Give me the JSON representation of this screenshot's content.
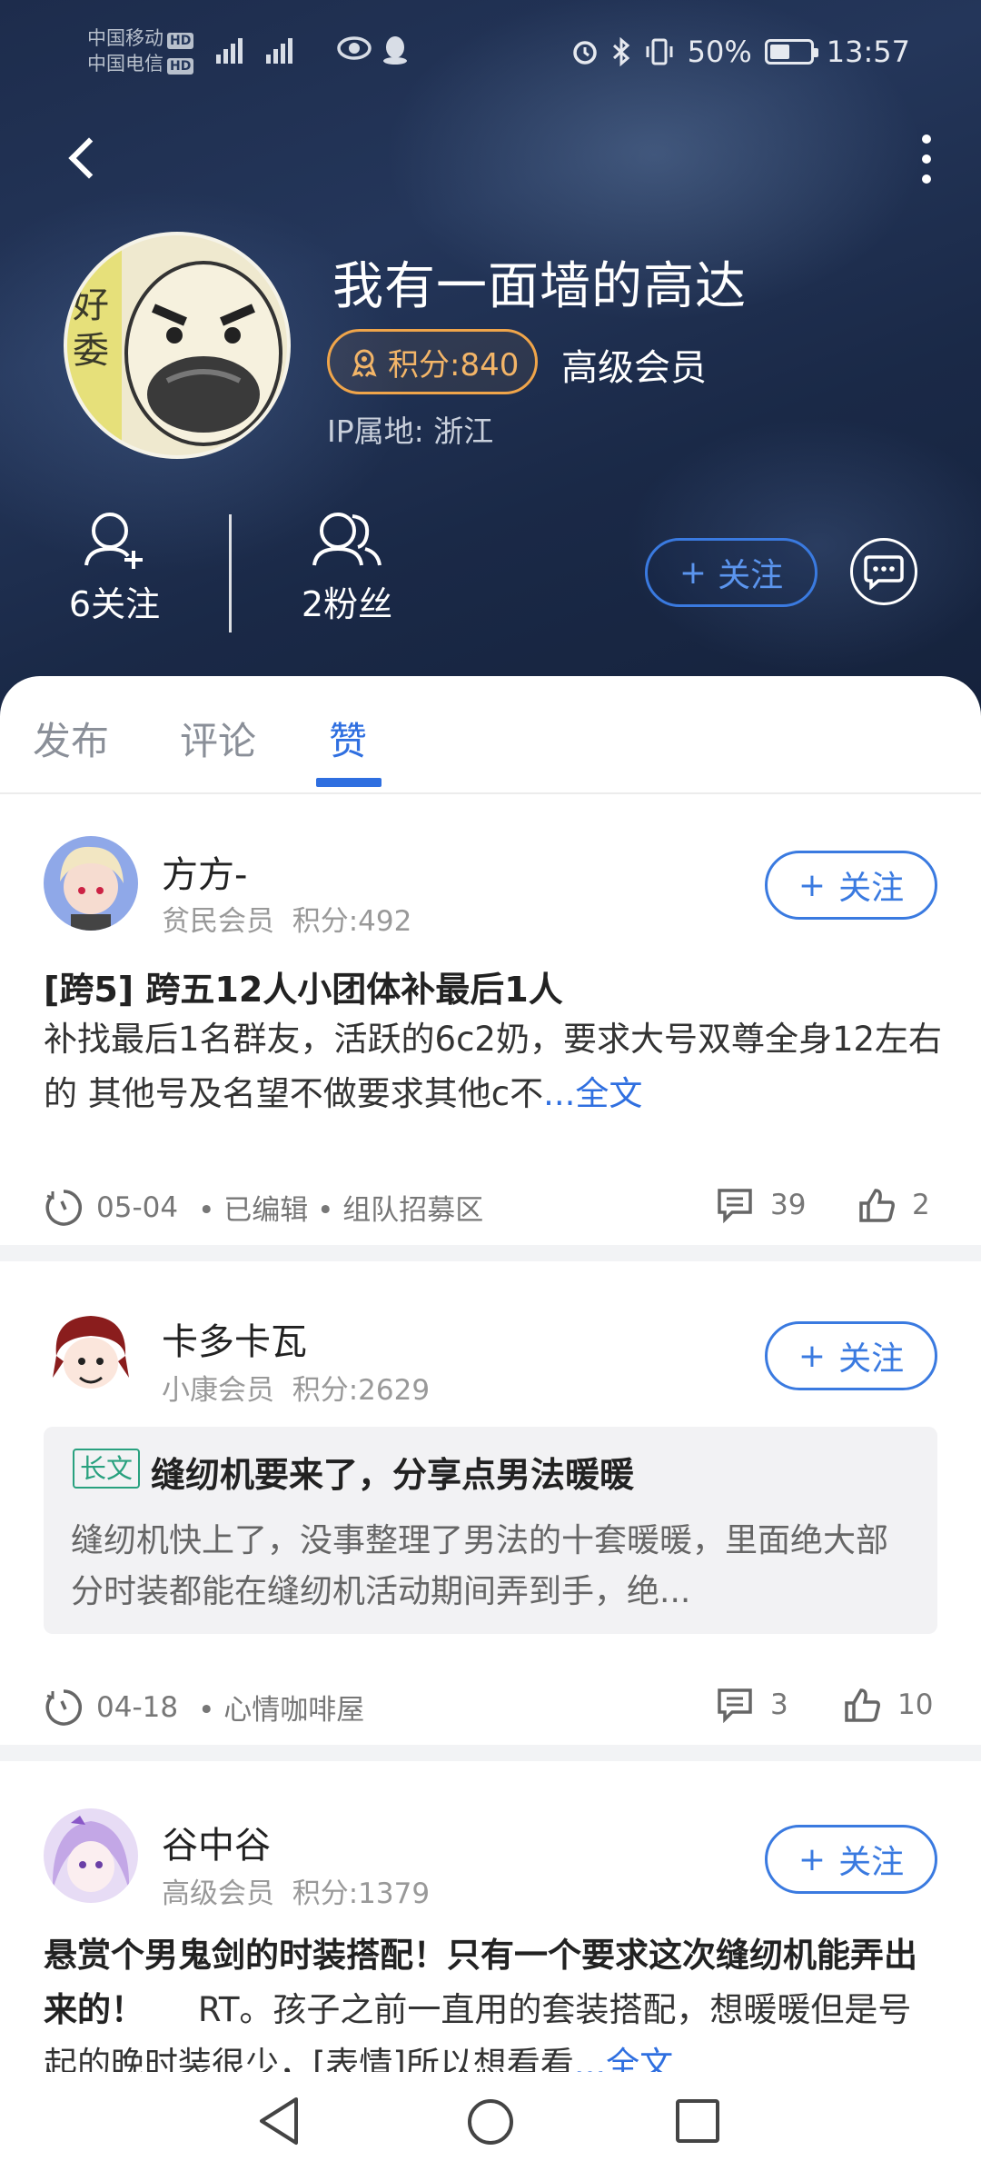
{
  "status_bar": {
    "carrier1": "中国移动",
    "carrier2": "中国电信",
    "hd": "HD",
    "battery": "50%",
    "battery_level": 0.5,
    "time": "13:57"
  },
  "profile": {
    "username": "我有一面墙的高达",
    "points": "积分:840",
    "member_level": "高级会员",
    "ip_location": "IP属地: 浙江",
    "following": "6关注",
    "followers": "2粉丝",
    "follow_label": "关注"
  },
  "tabs": [
    {
      "label": "发布"
    },
    {
      "label": "评论"
    },
    {
      "label": "赞"
    }
  ],
  "posts": [
    {
      "author": "方方-",
      "level": "贫民会员",
      "points": "积分:492",
      "follow_label": "关注",
      "title": "[跨5] 跨五12人小团体补最后1人",
      "body": " 补找最后1名群友，活跃的6c2奶，要求大号双尊全身12左右的 其他号及名望不做要求其他c不",
      "more": "...全文",
      "date": "05-04",
      "tags": "• 已编辑 • 组队招募区",
      "comments": "39",
      "likes": "2"
    },
    {
      "author": "卡多卡瓦",
      "level": "小康会员",
      "points": "积分:2629",
      "follow_label": "关注",
      "long_tag": "长文",
      "long_title": "缝纫机要来了，分享点男法暖暖",
      "long_body": "缝纫机快上了，没事整理了男法的十套暖暖，里面绝大部分时装都能在缝纫机活动期间弄到手，绝...",
      "date": "04-18",
      "tags": "• 心情咖啡屋",
      "comments": "3",
      "likes": "10"
    },
    {
      "author": "谷中谷",
      "level": "高级会员",
      "points": "积分:1379",
      "follow_label": "关注",
      "title": "悬赏个男鬼剑的时装搭配！只有一个要求这次缝纫机能弄出来的！",
      "body": "RT。孩子之前一直用的套装搭配，想暖暖但是号起的晚时装很少，[表情]所以想看看",
      "more": "...全文"
    }
  ]
}
